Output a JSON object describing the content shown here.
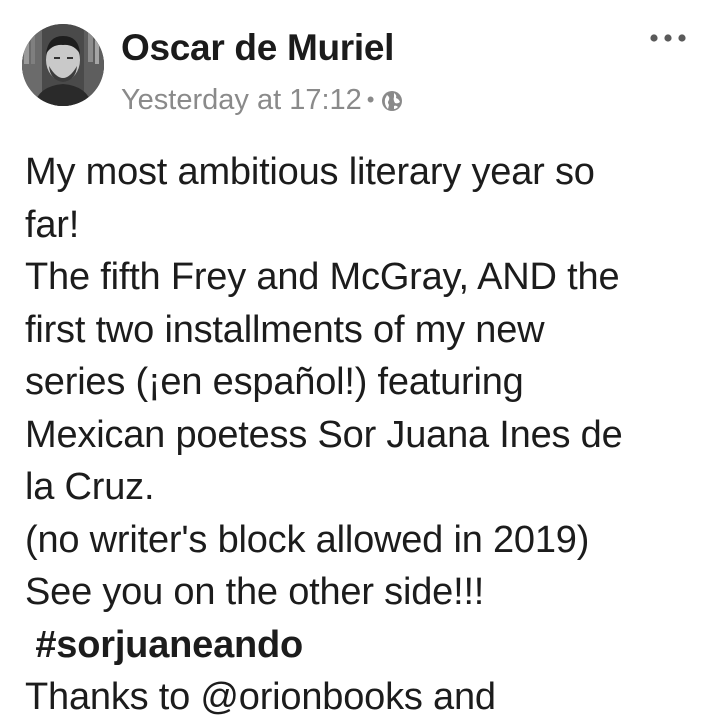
{
  "post": {
    "author": "Oscar de Muriel",
    "timestamp": "Yesterday at 17:12",
    "separator": "•",
    "privacy_icon": "globe-icon",
    "more_icon": "more-dots-icon",
    "body_lines": [
      "My most ambitious literary year so",
      "far!",
      "The fifth Frey and McGray, AND the",
      "first two installments of my new",
      "series (¡en español!) featuring",
      "Mexican poetess Sor Juana Ines de",
      "la Cruz.",
      "(no writer's block allowed in 2019)",
      "See you on the other side!!!"
    ],
    "hashtag": "#sorjuaneando",
    "last_line": "Thanks to @orionbooks and"
  },
  "colors": {
    "text": "#1c1c1c",
    "meta": "#8a8a8a",
    "background": "#ffffff"
  }
}
